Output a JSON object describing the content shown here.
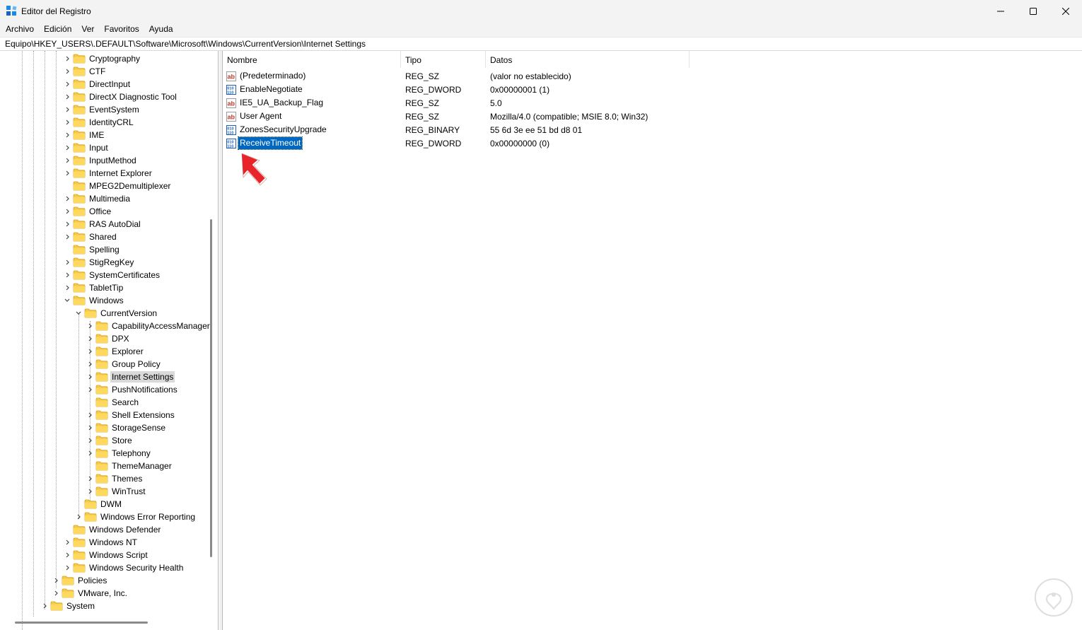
{
  "window": {
    "title": "Editor del Registro",
    "controls": [
      "minimize-icon",
      "maximize-icon",
      "close-icon"
    ]
  },
  "menu": [
    "Archivo",
    "Edición",
    "Ver",
    "Favoritos",
    "Ayuda"
  ],
  "address": "Equipo\\HKEY_USERS\\.DEFAULT\\Software\\Microsoft\\Windows\\CurrentVersion\\Internet Settings",
  "tree": [
    {
      "label": "Cryptography",
      "depth": 0,
      "expander": "collapsed"
    },
    {
      "label": "CTF",
      "depth": 0,
      "expander": "collapsed"
    },
    {
      "label": "DirectInput",
      "depth": 0,
      "expander": "collapsed"
    },
    {
      "label": "DirectX Diagnostic Tool",
      "depth": 0,
      "expander": "collapsed"
    },
    {
      "label": "EventSystem",
      "depth": 0,
      "expander": "collapsed"
    },
    {
      "label": "IdentityCRL",
      "depth": 0,
      "expander": "collapsed"
    },
    {
      "label": "IME",
      "depth": 0,
      "expander": "collapsed"
    },
    {
      "label": "Input",
      "depth": 0,
      "expander": "collapsed"
    },
    {
      "label": "InputMethod",
      "depth": 0,
      "expander": "collapsed"
    },
    {
      "label": "Internet Explorer",
      "depth": 0,
      "expander": "collapsed"
    },
    {
      "label": "MPEG2Demultiplexer",
      "depth": 0,
      "expander": "none"
    },
    {
      "label": "Multimedia",
      "depth": 0,
      "expander": "collapsed"
    },
    {
      "label": "Office",
      "depth": 0,
      "expander": "collapsed"
    },
    {
      "label": "RAS AutoDial",
      "depth": 0,
      "expander": "collapsed"
    },
    {
      "label": "Shared",
      "depth": 0,
      "expander": "collapsed"
    },
    {
      "label": "Spelling",
      "depth": 0,
      "expander": "none"
    },
    {
      "label": "StigRegKey",
      "depth": 0,
      "expander": "collapsed"
    },
    {
      "label": "SystemCertificates",
      "depth": 0,
      "expander": "collapsed"
    },
    {
      "label": "TabletTip",
      "depth": 0,
      "expander": "collapsed"
    },
    {
      "label": "Windows",
      "depth": 0,
      "expander": "expanded"
    },
    {
      "label": "CurrentVersion",
      "depth": 1,
      "expander": "expanded"
    },
    {
      "label": "CapabilityAccessManager",
      "depth": 2,
      "expander": "collapsed"
    },
    {
      "label": "DPX",
      "depth": 2,
      "expander": "collapsed"
    },
    {
      "label": "Explorer",
      "depth": 2,
      "expander": "collapsed"
    },
    {
      "label": "Group Policy",
      "depth": 2,
      "expander": "collapsed"
    },
    {
      "label": "Internet Settings",
      "depth": 2,
      "expander": "collapsed",
      "selected": true
    },
    {
      "label": "PushNotifications",
      "depth": 2,
      "expander": "collapsed"
    },
    {
      "label": "Search",
      "depth": 2,
      "expander": "none"
    },
    {
      "label": "Shell Extensions",
      "depth": 2,
      "expander": "collapsed"
    },
    {
      "label": "StorageSense",
      "depth": 2,
      "expander": "collapsed"
    },
    {
      "label": "Store",
      "depth": 2,
      "expander": "collapsed"
    },
    {
      "label": "Telephony",
      "depth": 2,
      "expander": "collapsed"
    },
    {
      "label": "ThemeManager",
      "depth": 2,
      "expander": "none"
    },
    {
      "label": "Themes",
      "depth": 2,
      "expander": "collapsed"
    },
    {
      "label": "WinTrust",
      "depth": 2,
      "expander": "collapsed"
    },
    {
      "label": "DWM",
      "depth": 1,
      "expander": "none"
    },
    {
      "label": "Windows Error Reporting",
      "depth": 1,
      "expander": "collapsed"
    },
    {
      "label": "Windows Defender",
      "depth": 0,
      "expander": "none"
    },
    {
      "label": "Windows NT",
      "depth": 0,
      "expander": "collapsed"
    },
    {
      "label": "Windows Script",
      "depth": 0,
      "expander": "collapsed"
    },
    {
      "label": "Windows Security Health",
      "depth": 0,
      "expander": "collapsed"
    },
    {
      "label": "Policies",
      "depth": -1,
      "expander": "collapsed"
    },
    {
      "label": "VMware, Inc.",
      "depth": -1,
      "expander": "collapsed"
    },
    {
      "label": "System",
      "depth": -2,
      "expander": "collapsed"
    }
  ],
  "list": {
    "columns": [
      "Nombre",
      "Tipo",
      "Datos"
    ],
    "rows": [
      {
        "name": "(Predeterminado)",
        "type": "REG_SZ",
        "data": "(valor no establecido)",
        "icon": "string-value-icon"
      },
      {
        "name": "EnableNegotiate",
        "type": "REG_DWORD",
        "data": "0x00000001 (1)",
        "icon": "binary-value-icon"
      },
      {
        "name": "IE5_UA_Backup_Flag",
        "type": "REG_SZ",
        "data": "5.0",
        "icon": "string-value-icon"
      },
      {
        "name": "User Agent",
        "type": "REG_SZ",
        "data": "Mozilla/4.0 (compatible; MSIE 8.0; Win32)",
        "icon": "string-value-icon"
      },
      {
        "name": "ZonesSecurityUpgrade",
        "type": "REG_BINARY",
        "data": "55 6d 3e ee 51 bd d8 01",
        "icon": "binary-value-icon"
      },
      {
        "name": "ReceiveTimeout",
        "type": "REG_DWORD",
        "data": "0x00000000 (0)",
        "icon": "binary-value-icon",
        "selected": true
      }
    ]
  },
  "colors": {
    "selection": "#0067c0",
    "tree_selection": "#d9d9d9",
    "folder": "#f7c948",
    "annotation_arrow": "#e8242a"
  }
}
